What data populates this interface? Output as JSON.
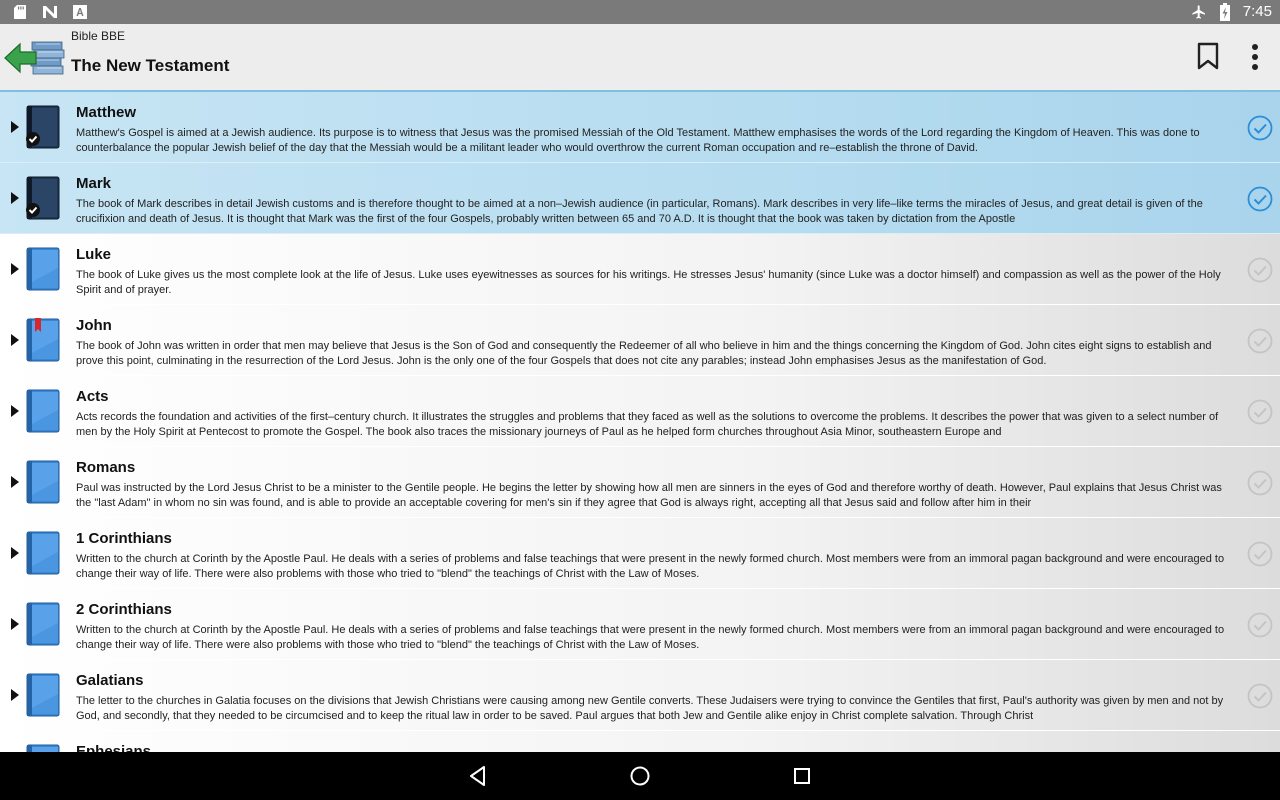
{
  "status_bar": {
    "left_icons": [
      "sd-card-icon",
      "n-app-icon",
      "a-app-icon"
    ],
    "right_icons": [
      "airplane-mode-icon",
      "battery-charging-icon"
    ],
    "time": "7:45"
  },
  "toolbar": {
    "app_name": "Bible BBE",
    "title": "The New Testament",
    "actions": [
      "bookmark-icon",
      "more-vert-icon"
    ]
  },
  "books": [
    {
      "title": "Matthew",
      "selected": true,
      "icon": "dark",
      "read": true,
      "description": "Matthew's Gospel is aimed at a Jewish audience. Its purpose is to witness that Jesus was the promised Messiah of the Old Testament. Matthew emphasises the words of the Lord regarding the Kingdom of Heaven. This was done to counterbalance the popular Jewish belief of the day that the Messiah would be a militant leader who would overthrow the current Roman occupation and re–establish the throne of David."
    },
    {
      "title": "Mark",
      "selected": true,
      "icon": "dark",
      "read": true,
      "description": "The book of Mark describes in detail Jewish customs and is therefore thought to be aimed at a non–Jewish audience (in particular, Romans). Mark describes in very life–like terms the miracles of Jesus, and great detail is given of the crucifixion and death of Jesus. It is thought that Mark was the first of the four Gospels, probably written between 65 and 70 A.D. It is thought that the book was taken by dictation from the Apostle"
    },
    {
      "title": "Luke",
      "selected": false,
      "icon": "blue",
      "read": false,
      "description": "The book of Luke gives us the most complete look at the life of Jesus. Luke uses eyewitnesses as sources for his writings. He stresses Jesus' humanity (since Luke was a doctor himself) and compassion as well as the power of the Holy Spirit and of prayer."
    },
    {
      "title": "John",
      "selected": false,
      "icon": "bookmarked",
      "read": false,
      "description": "The book of John was written in order that men may believe that Jesus is the Son of God and consequently the Redeemer of all who believe in him and the things concerning the Kingdom of God. John cites eight signs to establish and prove this point, culminating in the resurrection of the Lord Jesus. John is the only one of the four Gospels that does not cite any parables; instead John emphasises Jesus as the manifestation of God."
    },
    {
      "title": "Acts",
      "selected": false,
      "icon": "blue",
      "read": false,
      "description": "Acts records the foundation and activities of the first–century church. It illustrates the struggles and problems that they faced as well as the solutions to overcome the problems. It describes the power that was given to a select number of men by the Holy Spirit at Pentecost to promote the Gospel. The book also traces the missionary journeys of Paul as he helped form churches throughout Asia Minor, southeastern Europe and"
    },
    {
      "title": "Romans",
      "selected": false,
      "icon": "blue",
      "read": false,
      "description": "Paul was instructed by the Lord Jesus Christ to be a minister to the Gentile people. He begins the letter by showing how all men are sinners in the eyes of God and therefore worthy of death. However, Paul explains that Jesus Christ was the \"last Adam\" in whom no sin was found, and is able to provide an acceptable covering for men's sin if they agree that God is always right, accepting all that Jesus said and follow after him in their"
    },
    {
      "title": "1 Corinthians",
      "selected": false,
      "icon": "blue",
      "read": false,
      "description": "Written to the church at Corinth by the Apostle Paul. He deals with a series of problems and false teachings that were present in the newly formed church. Most members were from an immoral pagan background and were encouraged to change their way of life. There were also problems with those who tried to \"blend\" the teachings of Christ with the Law of Moses."
    },
    {
      "title": "2 Corinthians",
      "selected": false,
      "icon": "blue",
      "read": false,
      "description": "Written to the church at Corinth by the Apostle Paul. He deals with a series of problems and false teachings that were present in the newly formed church. Most members were from an immoral pagan background and were encouraged to change their way of life. There were also problems with those who tried to \"blend\" the teachings of Christ with the Law of Moses."
    },
    {
      "title": "Galatians",
      "selected": false,
      "icon": "blue",
      "read": false,
      "description": "The letter to the churches in Galatia focuses on the divisions that Jewish Christians were causing among new Gentile converts. These Judaisers were trying to convince the Gentiles that first, Paul's authority was given by men and not by God, and secondly, that they needed to be circumcised and to keep the ritual law in order to be saved. Paul argues that both Jew and Gentile alike enjoy in Christ complete salvation. Through Christ"
    },
    {
      "title": "Ephesians",
      "selected": false,
      "icon": "blue",
      "read": false,
      "description": ""
    }
  ],
  "nav_bar": [
    "back-icon",
    "home-icon",
    "recents-icon"
  ],
  "colors": {
    "selected_row": "#b6dcf0",
    "accent": "#2a8fd8",
    "book_blue": "#3a86d4",
    "book_dark": "#1f3550"
  }
}
